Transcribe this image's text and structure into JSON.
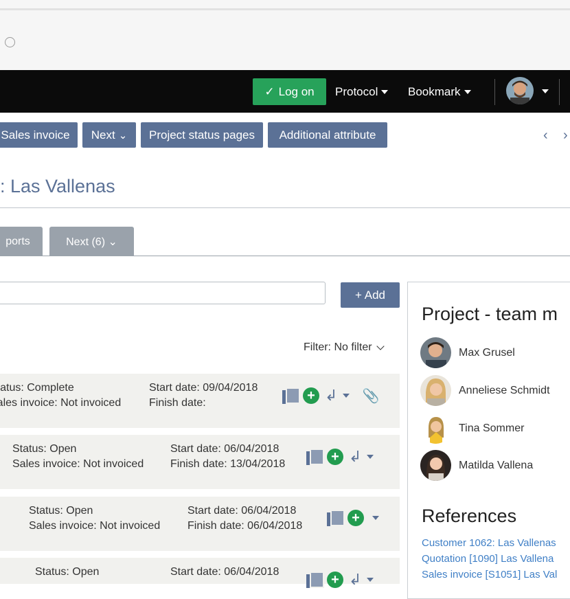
{
  "topnav": {
    "login_label": "Log on",
    "protocol_label": "Protocol",
    "bookmark_label": "Bookmark"
  },
  "toolbar": {
    "sales_invoice_label": "Sales invoice",
    "next_label": "Next",
    "project_status_label": "Project status pages",
    "additional_attribute_label": "Additional attribute"
  },
  "page": {
    "title": ": Las Vallenas"
  },
  "tabs": [
    {
      "label": "ports"
    },
    {
      "label": "Next (6) ⌄"
    }
  ],
  "task_input": {
    "placeholder": ""
  },
  "add_label": "+ Add",
  "filter_label": "Filter: No filter",
  "tasks": [
    {
      "status": "Status: Complete",
      "invoice": "Sales invoice: Not invoiced",
      "start": "Start date: 09/04/2018",
      "finish": "Finish date:"
    },
    {
      "status": "Status: Open",
      "invoice": "Sales invoice: Not invoiced",
      "start": "Start date: 06/04/2018",
      "finish": "Finish date: 13/04/2018"
    },
    {
      "status": "Status: Open",
      "invoice": "Sales invoice: Not invoiced",
      "start": "Start date: 06/04/2018",
      "finish": "Finish date: 06/04/2018"
    },
    {
      "status": "Status: Open",
      "invoice": "",
      "start": "Start date: 06/04/2018",
      "finish": ""
    }
  ],
  "team_panel": {
    "title": "Project - team m",
    "members": [
      {
        "name": "Max Grusel"
      },
      {
        "name": "Anneliese Schmidt"
      },
      {
        "name": "Tina Sommer"
      },
      {
        "name": "Matilda Vallena"
      }
    ]
  },
  "references": {
    "title": "References",
    "links": [
      "Customer 1062: Las Vallenas",
      "Quotation [1090] Las Vallena",
      "Sales invoice [S1051] Las Val"
    ]
  },
  "colors": {
    "nav_bg": "#0b0b0b",
    "primary": "#5b7196",
    "success": "#27a25a",
    "link": "#3f7fc6"
  }
}
